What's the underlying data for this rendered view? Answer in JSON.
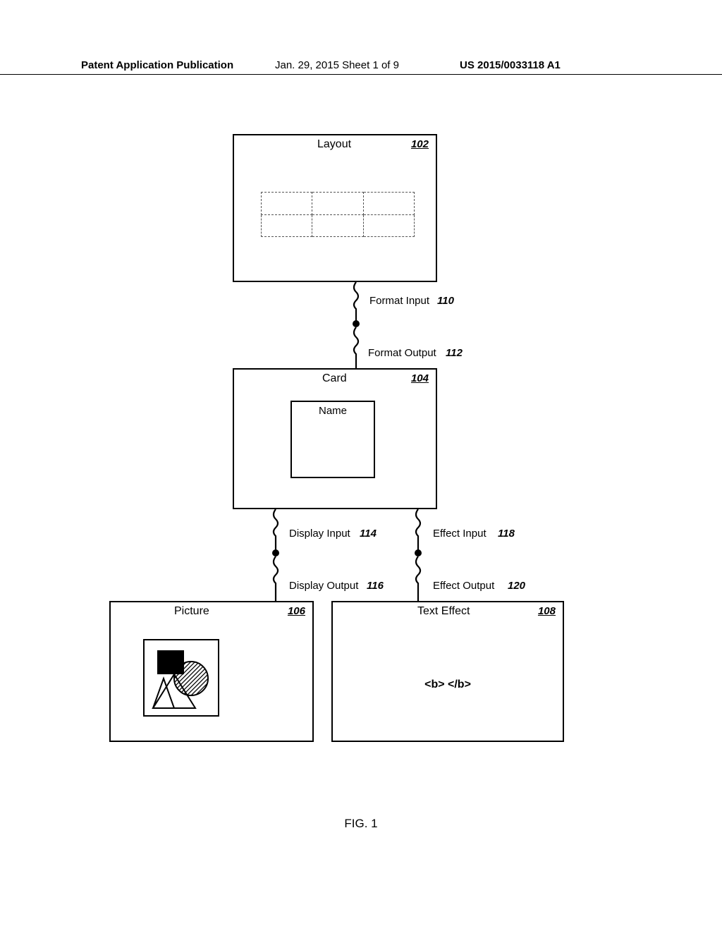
{
  "header": {
    "left": "Patent Application Publication",
    "mid": "Jan. 29, 2015  Sheet 1 of 9",
    "right": "US 2015/0033118 A1"
  },
  "layout": {
    "title": "Layout",
    "ref": "102"
  },
  "card": {
    "title": "Card",
    "ref": "104",
    "name_label": "Name"
  },
  "picture": {
    "title": "Picture",
    "ref": "106"
  },
  "effect": {
    "title": "Text Effect",
    "ref": "108",
    "body": "<b> </b>"
  },
  "connectors": {
    "format_input": {
      "label": "Format Input",
      "ref": "110"
    },
    "format_output": {
      "label": "Format Output",
      "ref": "112"
    },
    "display_input": {
      "label": "Display Input",
      "ref": "114"
    },
    "display_output": {
      "label": "Display Output",
      "ref": "116"
    },
    "effect_input": {
      "label": "Effect Input",
      "ref": "118"
    },
    "effect_output": {
      "label": "Effect Output",
      "ref": "120"
    }
  },
  "figure_caption": "FIG. 1"
}
